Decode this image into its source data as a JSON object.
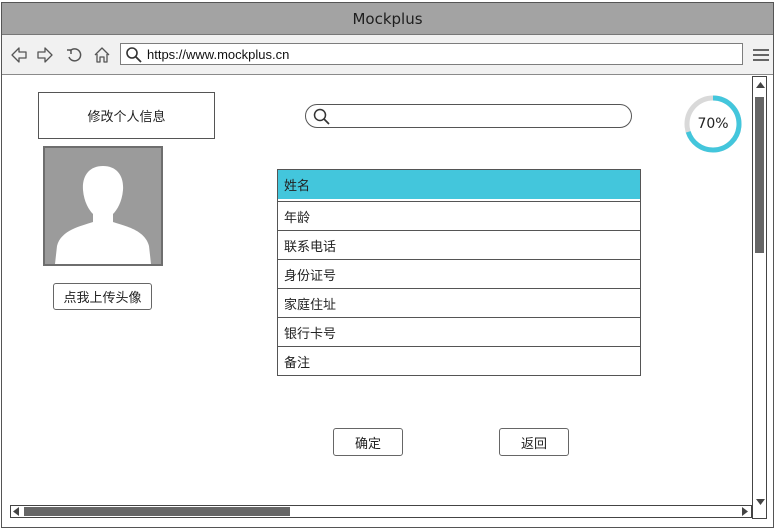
{
  "window": {
    "title": "Mockplus"
  },
  "address_bar": {
    "url": "https://www.mockplus.cn"
  },
  "page": {
    "edit_profile_button": "修改个人信息",
    "upload_avatar_button": "点我上传头像",
    "search": {
      "value": "",
      "placeholder": ""
    },
    "progress": {
      "label": "70%",
      "value": 0.7,
      "color": "#43c6dc",
      "track_color": "#d9d9d9"
    },
    "info_list": {
      "items": [
        "姓名",
        "年龄",
        "联系电话",
        "身份证号",
        "家庭住址",
        "银行卡号",
        "备注"
      ],
      "selected_index": 0,
      "selected_color": "#43c6dc"
    },
    "confirm_button": "确定",
    "back_button": "返回"
  },
  "icons": {
    "back": "arrow-left-icon",
    "forward": "arrow-right-icon",
    "refresh": "refresh-icon",
    "home": "home-icon",
    "url_search": "search-icon",
    "menu": "hamburger-menu-icon",
    "avatar": "user-silhouette-icon"
  }
}
